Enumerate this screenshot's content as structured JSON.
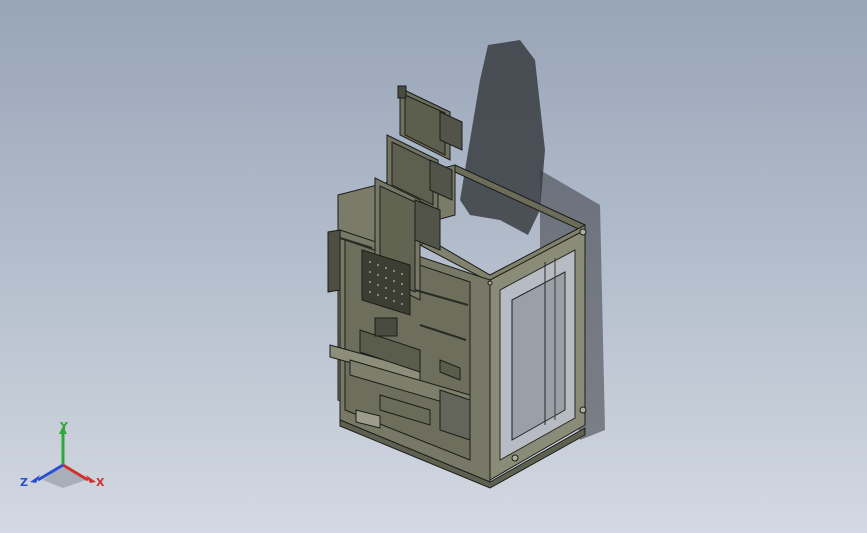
{
  "viewport": {
    "background_top": "#98a5b8",
    "background_bottom": "#d3d9e2",
    "model_color": "#6f7160",
    "edge_color": "#1c1c1a",
    "shadow_color": "#3a3d42"
  },
  "triad": {
    "x_label": "X",
    "y_label": "Y",
    "z_label": "Z",
    "x_color": "#d2302a",
    "y_color": "#2fa83a",
    "z_color": "#2c4fd0"
  }
}
